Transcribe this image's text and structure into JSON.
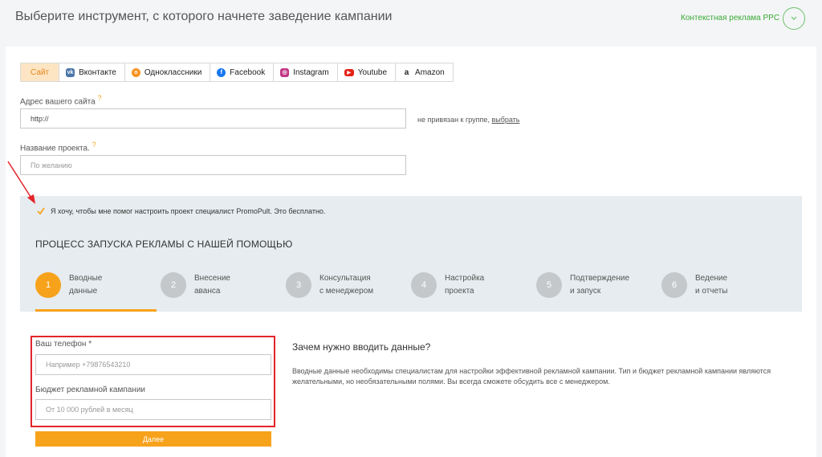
{
  "header": {
    "title": "Выберите инструмент, с которого начнете заведение кампании",
    "ppc_label": "Контекстная реклама PPC",
    "toggle_icon": "chevron-down-icon"
  },
  "tabs": [
    {
      "label": "Сайт",
      "icon": "none",
      "active": true
    },
    {
      "label": "Вконтакте",
      "icon": "vk-icon",
      "color": "#4a76a8"
    },
    {
      "label": "Одноклассники",
      "icon": "ok-icon",
      "color": "#f7931e"
    },
    {
      "label": "Facebook",
      "icon": "facebook-icon",
      "color": "#1877f2"
    },
    {
      "label": "Instagram",
      "icon": "instagram-icon",
      "color": "#c13584"
    },
    {
      "label": "Youtube",
      "icon": "youtube-icon",
      "color": "#e62117"
    },
    {
      "label": "Amazon",
      "icon": "amazon-icon",
      "color": "#222222"
    }
  ],
  "site": {
    "url_label": "Адрес вашего сайта",
    "url_value": "http://",
    "group_status": "не привязан к группе,",
    "group_link": "выбрать",
    "project_label": "Название проекта.",
    "project_placeholder": "По желанию",
    "help_mark": "?"
  },
  "consent": {
    "checked": true,
    "text": "Я хочу, чтобы мне помог настроить проект специалист PromoPult. Это бесплатно."
  },
  "process": {
    "title": "ПРОЦЕСС ЗАПУСКА РЕКЛАМЫ С НАШЕЙ ПОМОЩЬЮ",
    "steps": [
      {
        "num": "1",
        "line1": "Вводные",
        "line2": "данные",
        "active": true
      },
      {
        "num": "2",
        "line1": "Внесение",
        "line2": "аванса"
      },
      {
        "num": "3",
        "line1": "Консультация",
        "line2": "с менеджером"
      },
      {
        "num": "4",
        "line1": "Настройка",
        "line2": "проекта"
      },
      {
        "num": "5",
        "line1": "Подтверждение",
        "line2": "и запуск"
      },
      {
        "num": "6",
        "line1": "Ведение",
        "line2": "и отчеты"
      }
    ]
  },
  "form": {
    "phone_label": "Ваш телефон *",
    "phone_placeholder": "Например +79876543210",
    "budget_label": "Бюджет рекламной кампании",
    "budget_placeholder": "От 10 000 рублей в месяц",
    "next_button": "Далее"
  },
  "info": {
    "title": "Зачем нужно вводить данные?",
    "text": "Вводные данные необходимы специалистам для настройки эффективной рекламной кампании. Тип и бюджет рекламной кампании являются желательными, но необязательными полями. Вы всегда сможете обсудить все с менеджером."
  },
  "colors": {
    "accent": "#f7a21b",
    "highlight": "#e3242b",
    "ppc_green": "#3aaa35"
  }
}
